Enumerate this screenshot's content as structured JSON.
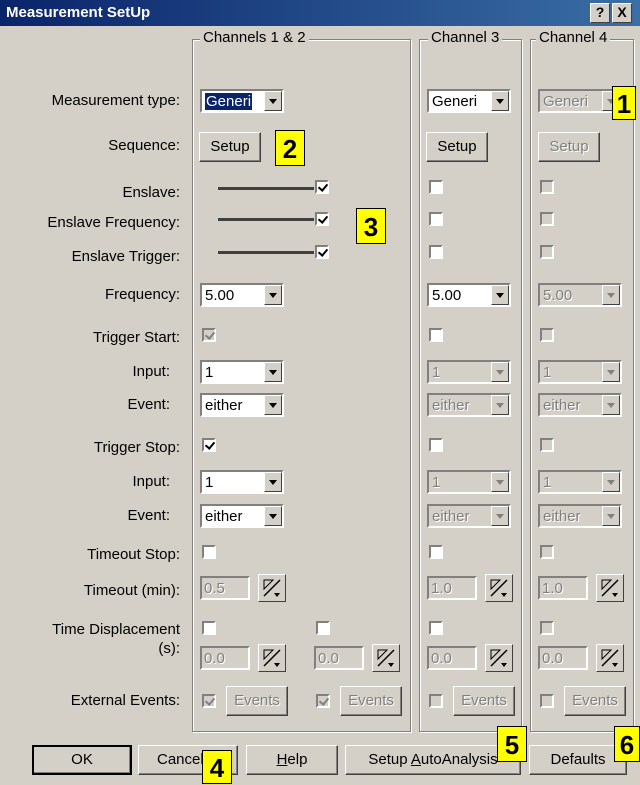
{
  "window": {
    "title": "Measurement SetUp",
    "help_btn": "?",
    "close_btn": "X"
  },
  "groups": {
    "ch12": "Channels 1 & 2",
    "ch3": "Channel 3",
    "ch4": "Channel 4"
  },
  "labels": {
    "measurement_type": "Measurement type:",
    "sequence": "Sequence:",
    "enslave": "Enslave:",
    "enslave_frequency": "Enslave Frequency:",
    "enslave_trigger": "Enslave Trigger:",
    "frequency": "Frequency:",
    "trigger_start": "Trigger Start:",
    "input1": "Input:",
    "event1": "Event:",
    "trigger_stop": "Trigger Stop:",
    "input2": "Input:",
    "event2": "Event:",
    "timeout_stop": "Timeout Stop:",
    "timeout_min": "Timeout (min):",
    "time_disp_1": "Time Displacement",
    "time_disp_2": "(s):",
    "external_events": "External Events:"
  },
  "ch12": {
    "measurement_type": "Generi",
    "setup": "Setup",
    "frequency": "5.00",
    "start_input": "1",
    "start_event": "either",
    "stop_input": "1",
    "stop_event": "either",
    "timeout": "0.5",
    "disp_a": "0.0",
    "disp_b": "0.0",
    "events_a": "Events",
    "events_b": "Events"
  },
  "ch3": {
    "measurement_type": "Generi",
    "setup": "Setup",
    "frequency": "5.00",
    "start_input": "1",
    "start_event": "either",
    "stop_input": "1",
    "stop_event": "either",
    "timeout": "1.0",
    "disp": "0.0",
    "events": "Events"
  },
  "ch4": {
    "measurement_type": "Generi",
    "setup": "Setup",
    "frequency": "5.00",
    "start_input": "1",
    "start_event": "either",
    "stop_input": "1",
    "stop_event": "either",
    "timeout": "1.0",
    "disp": "0.0",
    "events": "Events"
  },
  "buttons": {
    "ok": "OK",
    "cancel": "Cancel",
    "help": "Help",
    "setup_autoanalysis_pre": "Setup ",
    "setup_autoanalysis_ul": "A",
    "setup_autoanalysis_post": "utoAnalysis",
    "help_ul": "H",
    "help_post": "elp",
    "defaults": "Defaults"
  },
  "callouts": [
    "1",
    "2",
    "3",
    "4",
    "5",
    "6"
  ]
}
